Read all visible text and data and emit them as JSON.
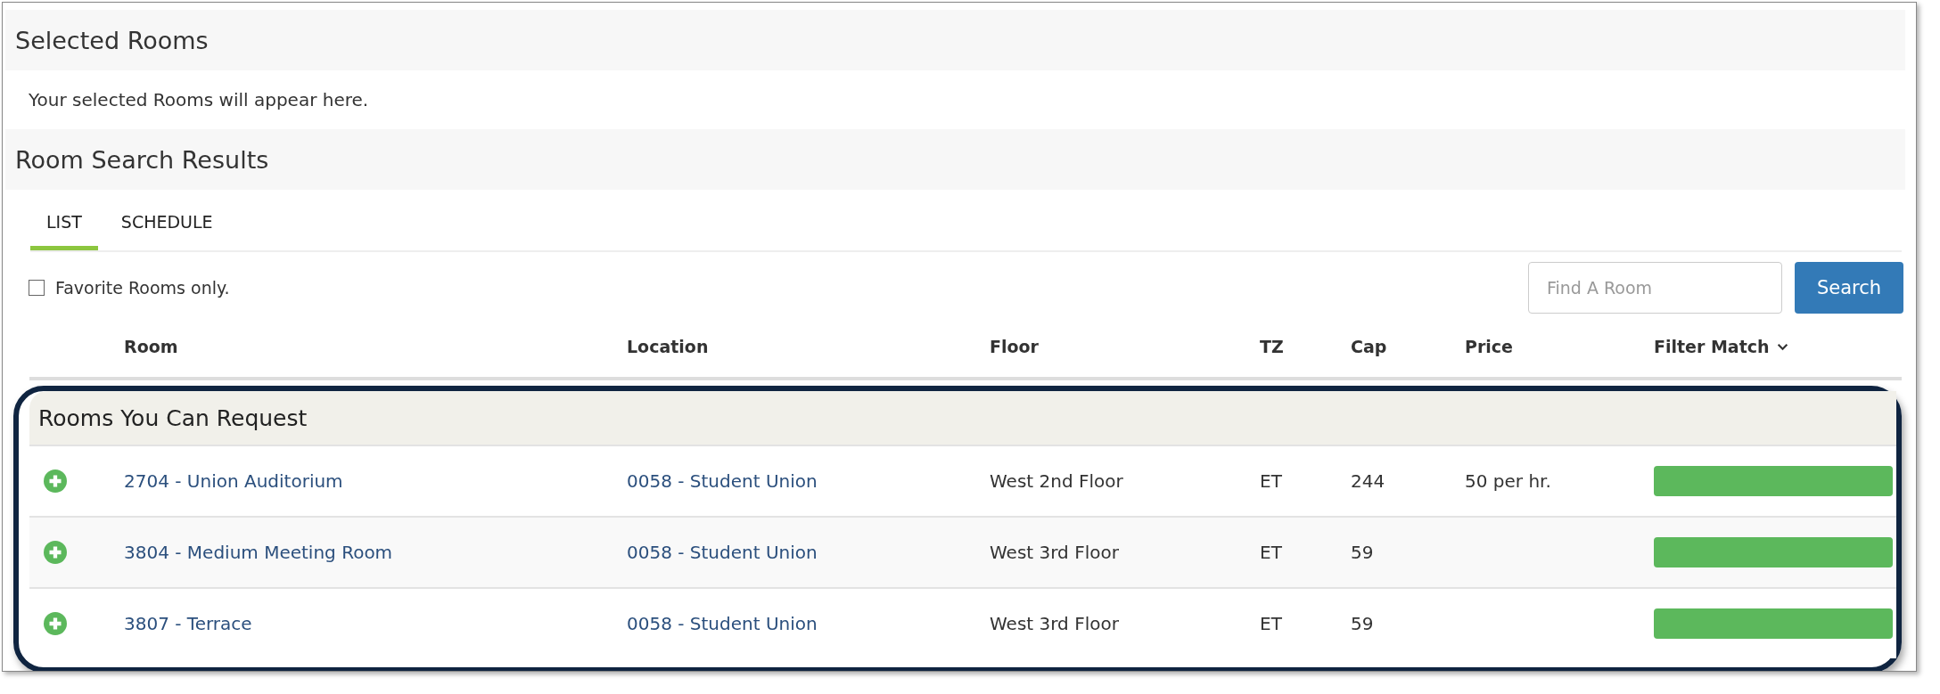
{
  "selected_panel": {
    "title": "Selected Rooms",
    "message": "Your selected Rooms will appear here."
  },
  "results_panel": {
    "title": "Room Search Results",
    "tabs": [
      {
        "label": "LIST",
        "selected": true
      },
      {
        "label": "SCHEDULE",
        "selected": false
      }
    ],
    "favorites_filter": {
      "label": "Favorite Rooms only.",
      "checked": false
    },
    "search": {
      "placeholder": "Find A Room",
      "button": "Search"
    },
    "table": {
      "columns": [
        {
          "label": "Room",
          "sorted": false
        },
        {
          "label": "Location",
          "sorted": false
        },
        {
          "label": "Floor",
          "sorted": false
        },
        {
          "label": "TZ",
          "sorted": false
        },
        {
          "label": "Cap",
          "sorted": false
        },
        {
          "label": "Price",
          "sorted": false
        },
        {
          "label": "Filter Match",
          "sorted": true
        }
      ],
      "groups": [
        {
          "title": "Rooms You Can Request",
          "highlighted": true,
          "rows": [
            {
              "room": "2704 - Union Auditorium",
              "location": "0058 - Student Union",
              "floor": "West 2nd Floor",
              "tz": "ET",
              "cap": "244",
              "price": "50 per hr.",
              "level": 1
            },
            {
              "room": "3804 - Medium Meeting Room",
              "location": "0058 - Student Union",
              "floor": "West 3rd Floor",
              "tz": "ET",
              "cap": "59",
              "level": 1
            },
            {
              "room": "3807 - Terrace",
              "location": "0058 - Student Union",
              "floor": "West 3rd Floor",
              "tz": "ET",
              "cap": "59",
              "level": 1
            }
          ]
        }
      ]
    }
  }
}
